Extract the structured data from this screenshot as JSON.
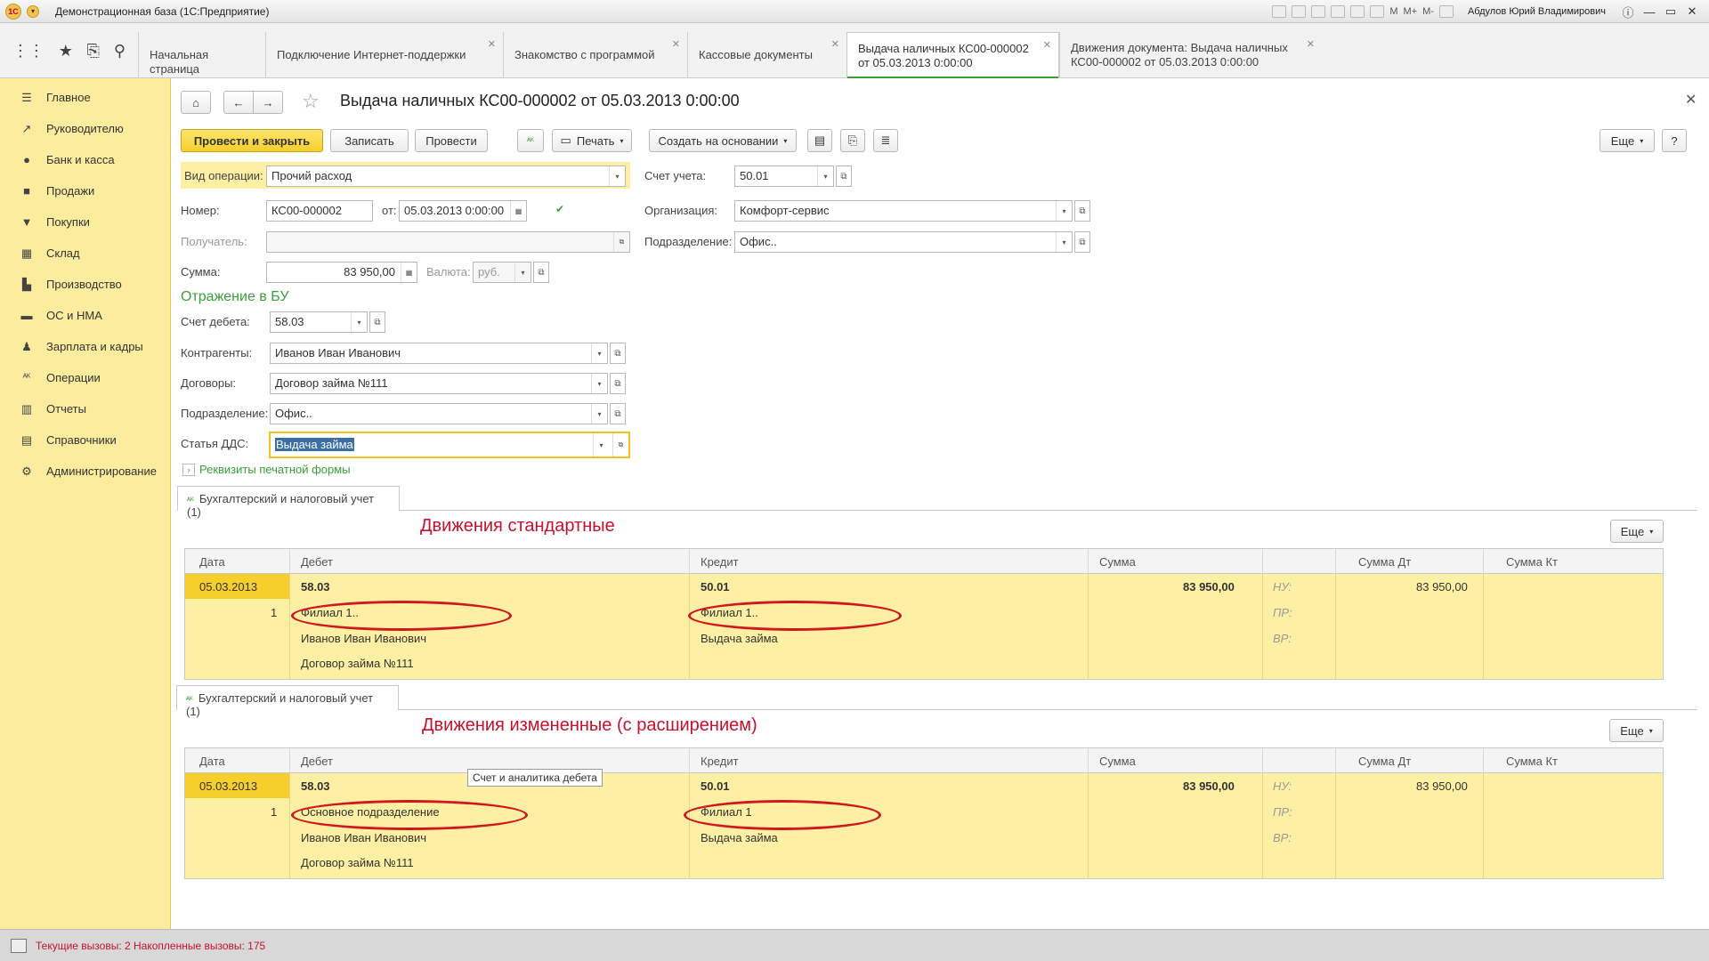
{
  "window": {
    "title": "Демонстрационная база  (1С:Предприятие)",
    "user": "Абдулов Юрий Владимирович"
  },
  "tabs": [
    {
      "label": "Начальная страница",
      "closable": false
    },
    {
      "label": "Подключение Интернет-поддержки",
      "closable": true
    },
    {
      "label": "Знакомство с программой",
      "closable": true
    },
    {
      "label": "Кассовые документы",
      "closable": true
    },
    {
      "label_line1": "Выдача наличных КС00-000002",
      "label_line2": "от 05.03.2013 0:00:00",
      "closable": true,
      "active": true
    },
    {
      "label_line1": "Движения документа: Выдача наличных",
      "label_line2": "КС00-000002 от 05.03.2013 0:00:00",
      "closable": true
    }
  ],
  "sidebar": {
    "items": [
      {
        "label": "Главное",
        "icon": "menu-icon"
      },
      {
        "label": "Руководителю",
        "icon": "chart-line-icon"
      },
      {
        "label": "Банк и касса",
        "icon": "coin-icon"
      },
      {
        "label": "Продажи",
        "icon": "bag-icon"
      },
      {
        "label": "Покупки",
        "icon": "cart-icon"
      },
      {
        "label": "Склад",
        "icon": "grid-icon"
      },
      {
        "label": "Производство",
        "icon": "factory-icon"
      },
      {
        "label": "ОС и НМА",
        "icon": "truck-icon"
      },
      {
        "label": "Зарплата и кадры",
        "icon": "person-icon"
      },
      {
        "label": "Операции",
        "icon": "dt-kt-icon"
      },
      {
        "label": "Отчеты",
        "icon": "bar-chart-icon"
      },
      {
        "label": "Справочники",
        "icon": "book-icon"
      },
      {
        "label": "Администрирование",
        "icon": "gear-icon"
      }
    ]
  },
  "doc": {
    "title": "Выдача наличных КС00-000002 от 05.03.2013 0:00:00",
    "toolbar": {
      "post_close": "Провести и закрыть",
      "save": "Записать",
      "post": "Провести",
      "print": "Печать",
      "create_based": "Создать на основании",
      "more": "Еще",
      "help": "?"
    },
    "fields": {
      "op_type_label": "Вид операции:",
      "op_type_value": "Прочий расход",
      "number_label": "Номер:",
      "number_value": "КС00-000002",
      "from_label": "от:",
      "date_value": "05.03.2013  0:00:00",
      "recipient_label": "Получатель:",
      "recipient_value": "",
      "sum_label": "Сумма:",
      "sum_value": "83 950,00",
      "currency_label": "Валюта:",
      "currency_value": "руб.",
      "account_label": "Счет учета:",
      "account_value": "50.01",
      "org_label": "Организация:",
      "org_value": "Комфорт-сервис",
      "dept_label": "Подразделение:",
      "dept_value": "Офис.."
    },
    "bu": {
      "title": "Отражение в БУ",
      "debit_label": "Счет дебета:",
      "debit_value": "58.03",
      "contractors_label": "Контрагенты:",
      "contractors_value": "Иванов Иван Иванович",
      "contracts_label": "Договоры:",
      "contracts_value": "Договор займа №111",
      "dept_label": "Подразделение:",
      "dept_value": "Офис..",
      "dds_label": "Статья ДДС:",
      "dds_value": "Выдача займа"
    },
    "print_props": "Реквизиты печатной формы"
  },
  "movements": [
    {
      "tab": "Бухгалтерский и налоговый учет (1)",
      "heading": "Движения стандартные",
      "more": "Еще",
      "columns": [
        "Дата",
        "Дебет",
        "Кредит",
        "Сумма",
        "",
        "Сумма Дт",
        "Сумма Кт"
      ],
      "row": {
        "date": "05.03.2013",
        "num": "1",
        "debit": "58.03",
        "debit_sub1": "Филиал 1..",
        "debit_sub2": "Иванов Иван Иванович",
        "debit_sub3": "Договор займа №111",
        "credit": "50.01",
        "credit_sub1": "Филиал 1..",
        "credit_sub2": "Выдача займа",
        "sum": "83 950,00",
        "nu": "НУ:",
        "pr": "ПР:",
        "vr": "ВР:",
        "sum_dt": "83 950,00"
      }
    },
    {
      "tab": "Бухгалтерский и налоговый учет (1)",
      "heading": "Движения измененные (с расширением)",
      "more": "Еще",
      "columns": [
        "Дата",
        "Дебет",
        "Кредит",
        "Сумма",
        "",
        "Сумма Дт",
        "Сумма Кт"
      ],
      "tooltip": "Счет и аналитика дебета",
      "row": {
        "date": "05.03.2013",
        "num": "1",
        "debit": "58.03",
        "debit_sub1": "Основное подразделение",
        "debit_sub2": "Иванов Иван Иванович",
        "debit_sub3": "Договор займа №111",
        "credit": "50.01",
        "credit_sub1": "Филиал 1",
        "credit_sub2": "Выдача займа",
        "sum": "83 950,00",
        "nu": "НУ:",
        "pr": "ПР:",
        "vr": "ВР:",
        "sum_dt": "83 950,00"
      }
    }
  ],
  "status": {
    "text": "Текущие вызовы: 2   Накопленные вызовы: 175"
  }
}
